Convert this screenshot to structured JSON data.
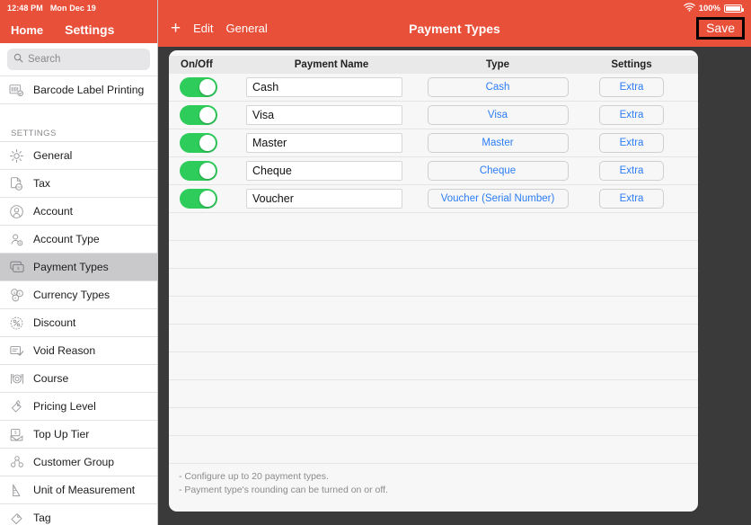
{
  "status_bar": {
    "time": "12:48 PM",
    "date": "Mon Dec 19",
    "battery_percent": "100%",
    "wifi_icon": "wifi-icon",
    "battery_icon": "battery-icon"
  },
  "sidebar": {
    "back_label": "Home",
    "title": "Settings",
    "search": {
      "placeholder": "Search",
      "value": "",
      "icon": "search-icon"
    },
    "top_items": [
      {
        "label": "Barcode Label Printing",
        "icon": "barcode-icon",
        "selected": false
      }
    ],
    "group_header": "SETTINGS",
    "items": [
      {
        "label": "General",
        "icon": "gear-icon",
        "selected": false
      },
      {
        "label": "Tax",
        "icon": "tax-document-icon",
        "selected": false
      },
      {
        "label": "Account",
        "icon": "person-circle-icon",
        "selected": false
      },
      {
        "label": "Account Type",
        "icon": "person-gear-icon",
        "selected": false
      },
      {
        "label": "Payment Types",
        "icon": "card-stack-icon",
        "selected": true
      },
      {
        "label": "Currency Types",
        "icon": "coins-icon",
        "selected": false
      },
      {
        "label": "Discount",
        "icon": "percent-badge-icon",
        "selected": false
      },
      {
        "label": "Void Reason",
        "icon": "note-check-icon",
        "selected": false
      },
      {
        "label": "Course",
        "icon": "plate-cutlery-icon",
        "selected": false
      },
      {
        "label": "Pricing Level",
        "icon": "price-tag-arrow-icon",
        "selected": false
      },
      {
        "label": "Top Up Tier",
        "icon": "envelope-money-icon",
        "selected": false
      },
      {
        "label": "Customer Group",
        "icon": "people-group-icon",
        "selected": false
      },
      {
        "label": "Unit of Measurement",
        "icon": "ruler-icon",
        "selected": false
      },
      {
        "label": "Tag",
        "icon": "tag-icon",
        "selected": false
      }
    ]
  },
  "toolbar": {
    "add_label": "+",
    "edit_label": "Edit",
    "general_label": "General",
    "title": "Payment Types",
    "save_label": "Save"
  },
  "table": {
    "columns": [
      "On/Off",
      "Payment Name",
      "Type",
      "Settings"
    ],
    "rows": [
      {
        "enabled": true,
        "name": "Cash",
        "type": "Cash",
        "settings": "Extra"
      },
      {
        "enabled": true,
        "name": "Visa",
        "type": "Visa",
        "settings": "Extra"
      },
      {
        "enabled": true,
        "name": "Master",
        "type": "Master",
        "settings": "Extra"
      },
      {
        "enabled": true,
        "name": "Cheque",
        "type": "Cheque",
        "settings": "Extra"
      },
      {
        "enabled": true,
        "name": "Voucher",
        "type": "Voucher (Serial Number)",
        "settings": "Extra"
      }
    ],
    "empty_row_count": 9
  },
  "footnotes": [
    "- Configure up to 20 payment types.",
    "- Payment type's rounding can be turned on or off."
  ],
  "colors": {
    "accent_red": "#E8503A",
    "toggle_green": "#2ECC5A",
    "link_blue": "#2b7df5",
    "frame_dark": "#3a3a3a",
    "selected_gray": "#c9c9cc"
  }
}
